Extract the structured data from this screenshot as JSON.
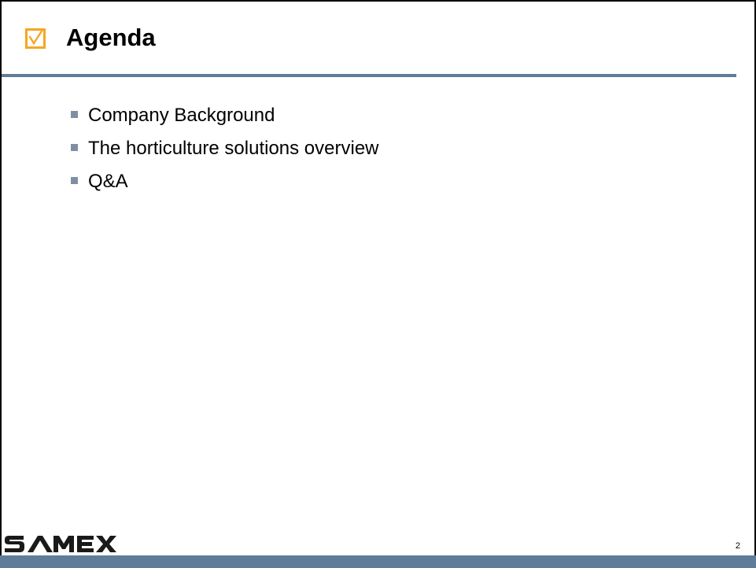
{
  "slide": {
    "title": "Agenda",
    "title_icon": "checkbox-checked-icon",
    "bullets": [
      {
        "text": "Company Background"
      },
      {
        "text": "The horticulture solutions overview"
      },
      {
        "text": "Q&A"
      }
    ],
    "page_number": "2"
  },
  "footer": {
    "logo_text": "SAMEX",
    "logo_icon": "samex-logo"
  },
  "colors": {
    "accent_rule": "#5f7c99",
    "icon_accent": "#f6a623",
    "bullet_marker": "#7f8fa3"
  }
}
